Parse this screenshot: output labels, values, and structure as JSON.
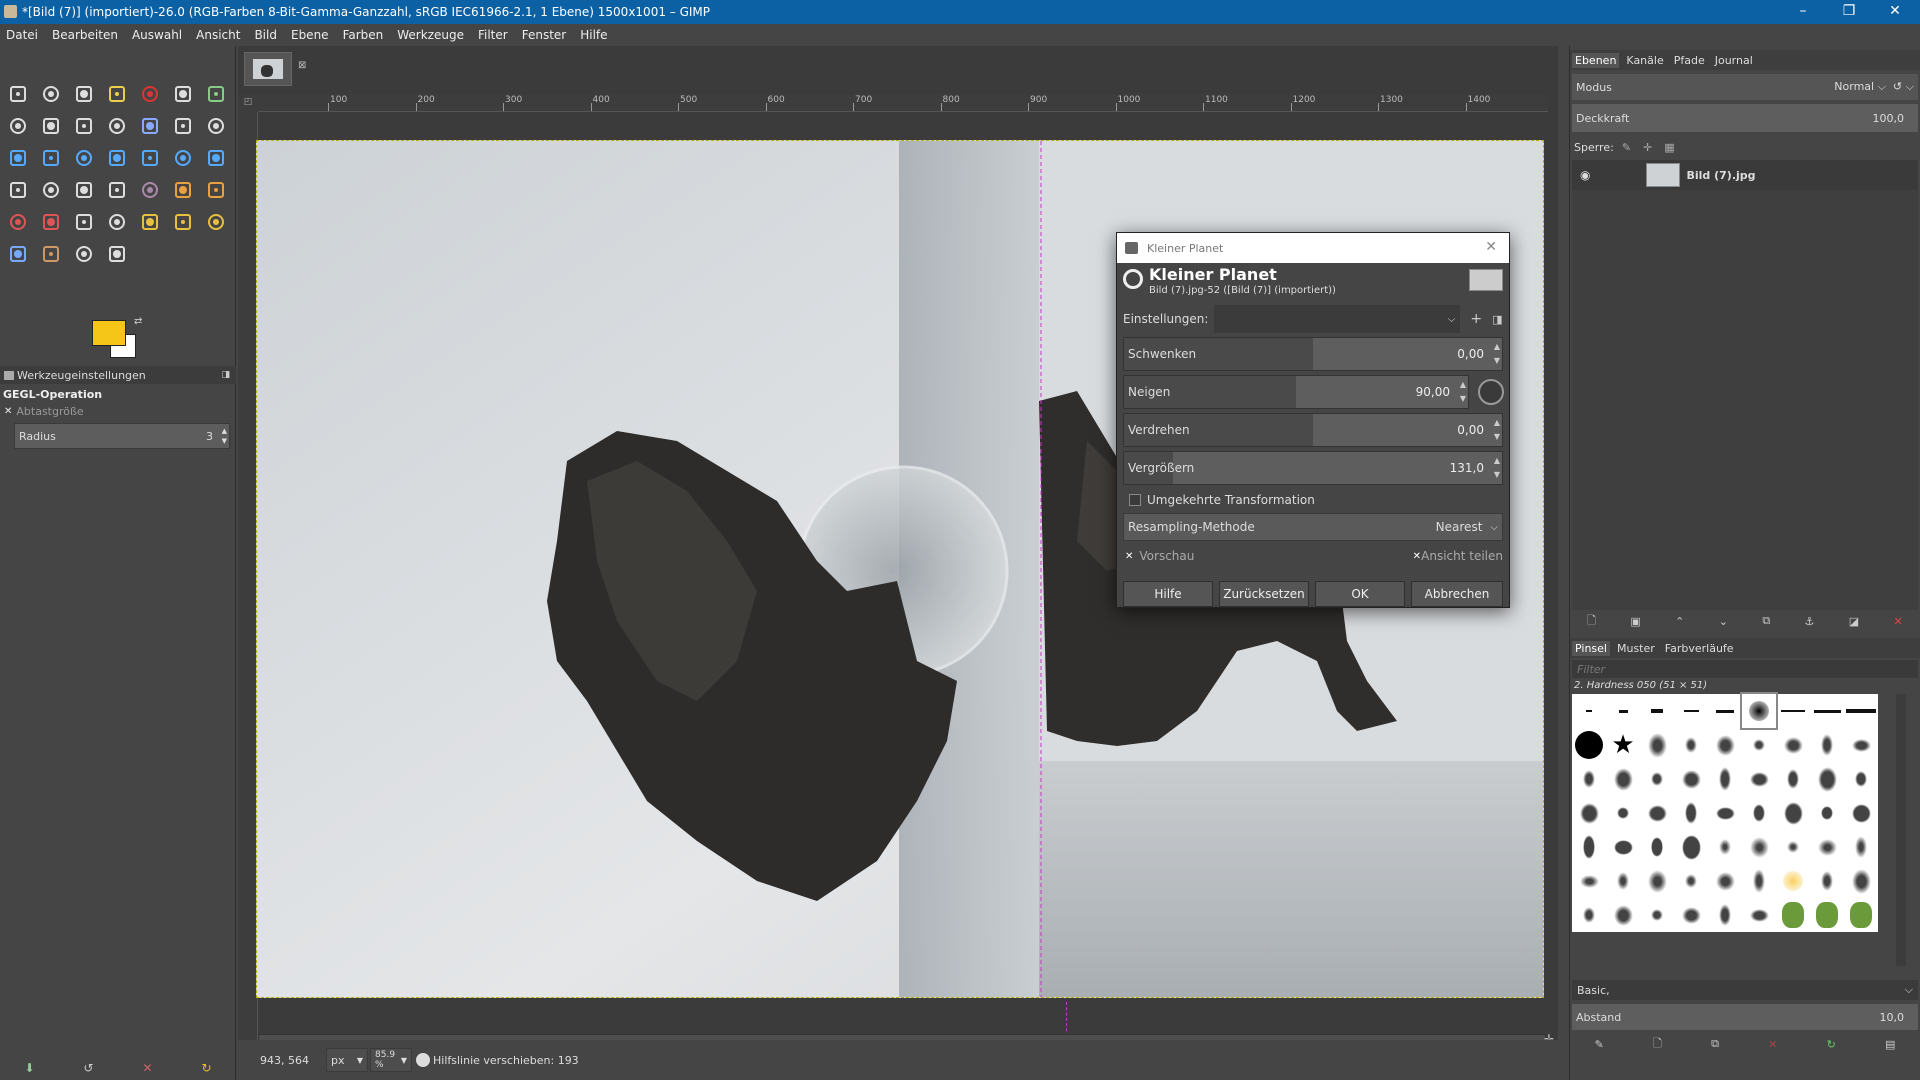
{
  "window": {
    "title": "*[Bild (7)] (importiert)-26.0 (RGB-Farben 8-Bit-Gamma-Ganzzahl, sRGB IEC61966-2.1, 1 Ebene) 1500x1001 – GIMP",
    "minimize": "–",
    "restore": "❐",
    "close": "✕"
  },
  "menu": [
    "Datei",
    "Bearbeiten",
    "Auswahl",
    "Ansicht",
    "Bild",
    "Ebene",
    "Farben",
    "Werkzeuge",
    "Filter",
    "Fenster",
    "Hilfe"
  ],
  "tools": [
    "rect-select",
    "ellipse-select",
    "free-select",
    "fuzzy-select",
    "by-color-select",
    "scissors-select",
    "foreground-select",
    "alignment",
    "paths",
    "zoom",
    "measure",
    "move",
    "align-layers",
    "crop",
    "unified-transform",
    "rotate",
    "scale",
    "shear",
    "perspective",
    "flip",
    "cage-transform",
    "warp-transform",
    "handle-transform",
    "text",
    "bucket-fill",
    "gradient",
    "pencil",
    "paintbrush",
    "eraser",
    "airbrush",
    "ink",
    "mypaint-brush",
    "clone",
    "heal",
    "perspective-clone",
    "smudge",
    "blur-sharpen",
    "dodge-burn",
    "color-picker"
  ],
  "colors": {
    "foreground": "#f5c518",
    "background": "#ffffff",
    "accent": "#0b61a4"
  },
  "tool_options": {
    "tab_label": "Werkzeugeinstellungen",
    "heading": "GEGL-Operation",
    "sample_size_label": "Abtastgröße",
    "radius_label": "Radius",
    "radius_value": "3"
  },
  "ruler": {
    "labels": [
      "100",
      "200",
      "300",
      "400",
      "500",
      "600",
      "700",
      "800",
      "900",
      "1000",
      "1100",
      "1200",
      "1300",
      "1400"
    ]
  },
  "status": {
    "coords": "943, 564",
    "unit": "px",
    "zoom": "85.9 %",
    "message": "Hilfslinie verschieben: 193"
  },
  "dialog": {
    "window_title": "Kleiner Planet",
    "title": "Kleiner Planet",
    "subtitle": "Bild (7).jpg-52 ([Bild (7)] (importiert))",
    "settings_label": "Einstellungen:",
    "settings_value": "",
    "sliders": [
      {
        "label": "Schwenken",
        "value": "0,00",
        "fill": 0.5
      },
      {
        "label": "Neigen",
        "value": "90,00",
        "fill": 0.5
      },
      {
        "label": "Verdrehen",
        "value": "0,00",
        "fill": 0.5
      },
      {
        "label": "Vergrößern",
        "value": "131,0",
        "fill": 0.13
      }
    ],
    "inverse_label": "Umgekehrte Transformation",
    "resampling_label": "Resampling-Methode",
    "resampling_value": "Nearest",
    "preview_label": "Vorschau",
    "split_label": "Ansicht teilen",
    "buttons": {
      "help": "Hilfe",
      "reset": "Zurücksetzen",
      "ok": "OK",
      "cancel": "Abbrechen"
    }
  },
  "layers_panel": {
    "tabs": [
      "Ebenen",
      "Kanäle",
      "Pfade",
      "Journal"
    ],
    "mode_label": "Modus",
    "mode_value": "Normal",
    "opacity_label": "Deckkraft",
    "opacity_value": "100,0",
    "lock_label": "Sperre:",
    "layer_name": "Bild (7).jpg"
  },
  "brushes_panel": {
    "tabs": [
      "Pinsel",
      "Muster",
      "Farbverläufe"
    ],
    "filter_placeholder": "Filter",
    "current_brush": "2. Hardness 050 (51 × 51)",
    "preset": "Basic,",
    "spacing_label": "Abstand",
    "spacing_value": "10,0"
  }
}
